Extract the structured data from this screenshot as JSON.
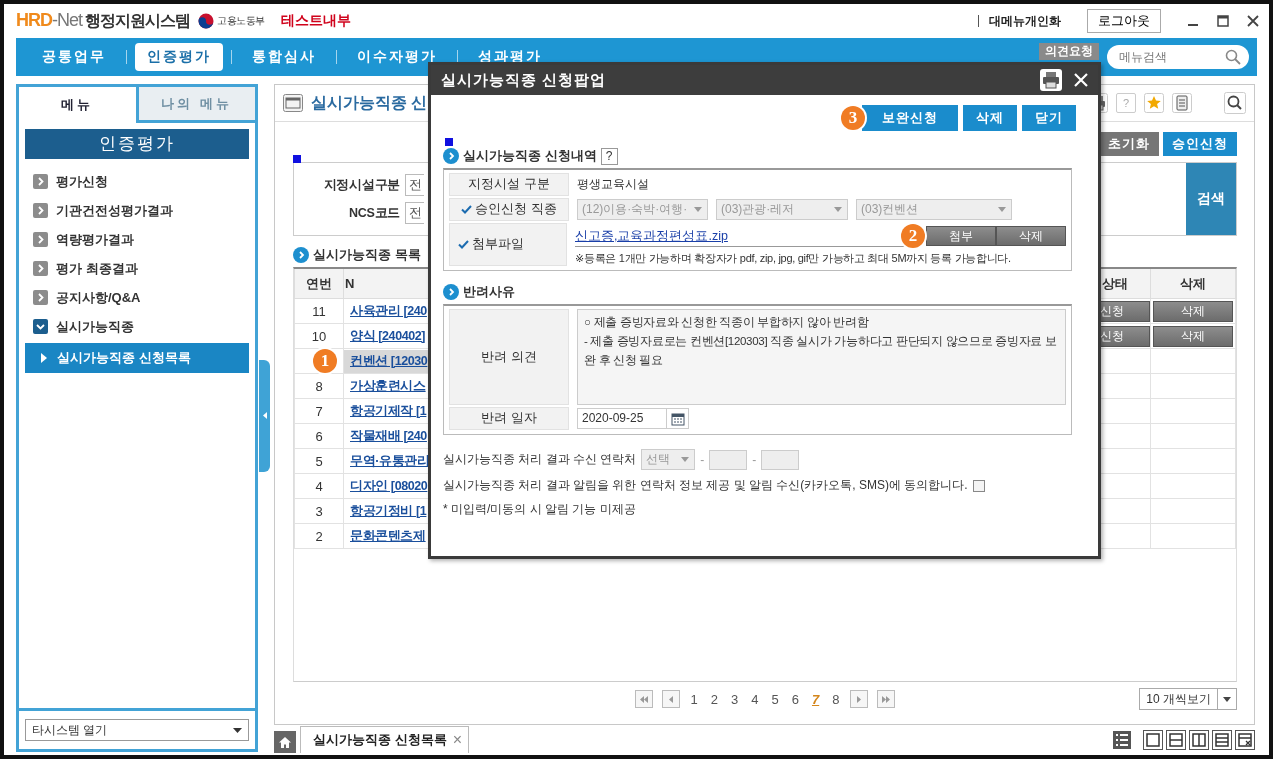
{
  "app": {
    "logo_mark": "HRD",
    "logo_net": "-Net",
    "logo_title": "행정지원시스템",
    "ministry": "고용노동부",
    "env_label": "테스트내부",
    "personalize": "대메뉴개인화",
    "logout": "로그아웃"
  },
  "nav": {
    "items": [
      {
        "label": "공통업무",
        "selected": false
      },
      {
        "label": "인증평가",
        "selected": true
      },
      {
        "label": "통합심사",
        "selected": false
      },
      {
        "label": "이수자평가",
        "selected": false
      },
      {
        "label": "성과평가",
        "selected": false
      }
    ],
    "feedback": "의견요청",
    "search_placeholder": "메뉴검색"
  },
  "sidebar": {
    "tabs": [
      {
        "label": "메뉴",
        "selected": true
      },
      {
        "label": "나의 메뉴",
        "selected": false
      }
    ],
    "title": "인증평가",
    "items": [
      {
        "label": "평가신청",
        "expanded": false
      },
      {
        "label": "기관건전성평가결과",
        "expanded": false
      },
      {
        "label": "역량평가결과",
        "expanded": false
      },
      {
        "label": "평가 최종결과",
        "expanded": false
      },
      {
        "label": "공지사항/Q&A",
        "expanded": false
      },
      {
        "label": "실시가능직종",
        "expanded": true,
        "children": [
          {
            "label": "실시가능직종 신청목록",
            "selected": true
          }
        ]
      }
    ],
    "system_select": "타시스템 열기"
  },
  "main": {
    "title": "실시가능직종 신",
    "toolbar_help": "?",
    "buttons": [
      {
        "label": "초기화",
        "kind": "secondary"
      },
      {
        "label": "승인신청",
        "kind": "primary"
      }
    ],
    "filters": [
      {
        "label": "지정시설구분",
        "value": "전"
      },
      {
        "label": "NCS코드",
        "value": "전"
      }
    ],
    "search_button": "검색",
    "list_title": "실시가능직종 목록",
    "table": {
      "columns": [
        "연번",
        "N",
        "상태",
        "삭제"
      ],
      "rows": [
        {
          "no": "11",
          "name": "사육관리 [240",
          "status": "신청",
          "delete": "삭제",
          "selected": false
        },
        {
          "no": "10",
          "name": "양식 [240402]",
          "status": "신청",
          "delete": "삭제",
          "selected": false
        },
        {
          "callout": "1",
          "name": "컨벤션 [12030",
          "selected": true
        },
        {
          "no": "8",
          "name": "가상훈련시스",
          "selected": false
        },
        {
          "no": "7",
          "name": "항공기제작 [1",
          "selected": false
        },
        {
          "no": "6",
          "name": "작물재배 [240",
          "selected": false
        },
        {
          "no": "5",
          "name": "무역·유통관리",
          "selected": false
        },
        {
          "no": "4",
          "name": "디자인 [08020",
          "selected": false
        },
        {
          "no": "3",
          "name": "항공기정비 [1",
          "selected": false
        },
        {
          "no": "2",
          "name": "문화콘텐츠제",
          "selected": false
        }
      ]
    },
    "pages": [
      {
        "label": "1",
        "selected": false
      },
      {
        "label": "2",
        "selected": false
      },
      {
        "label": "3",
        "selected": false
      },
      {
        "label": "4",
        "selected": false
      },
      {
        "label": "5",
        "selected": false
      },
      {
        "label": "6",
        "selected": false
      },
      {
        "label": "7",
        "selected": true
      },
      {
        "label": "8",
        "selected": false
      }
    ],
    "page_size": "10 개씩보기"
  },
  "bottom_tabs": [
    {
      "label": "실시가능직종 신청목록",
      "close": "×",
      "selected": true
    }
  ],
  "popup": {
    "title": "실시가능직종 신청팝업",
    "actions": [
      {
        "label": "보완신청",
        "callout": "3"
      },
      {
        "label": "삭제"
      },
      {
        "label": "닫기"
      }
    ],
    "application": {
      "title": "실시가능직종 신청내역",
      "help": "?",
      "facility_label": "지정시설 구분",
      "facility_value": "평생교육시설",
      "job_label": "승인신청 직종",
      "job_selects": [
        "(12)이용·숙박·여행·",
        "(03)관광·레저",
        "(03)컨벤션"
      ],
      "file_label": "첨부파일",
      "file_name": "신고증,교육과정편성표.zip",
      "file_callout": "2",
      "file_buttons": [
        "첨부",
        "삭제"
      ],
      "file_note": "※등록은 1개만 가능하며 확장자가 pdf, zip, jpg, gif만 가능하고 최대 5M까지 등록 가능합니다."
    },
    "rejection": {
      "title": "반려사유",
      "opinion_label": "반려 의견",
      "opinion_text": "○ 제출 증빙자료와 신청한 직종이 부합하지 않아 반려함\n - 제출 증빙자료로는 컨벤션[120303] 직종 실시가 가능하다고 판단되지 않으므로 증빙자료 보완 후 신청 필요",
      "date_label": "반려 일자",
      "date_value": "2020-09-25"
    },
    "contact": {
      "label": "실시가능직종 처리 결과 수신 연락처",
      "select": "선택",
      "separators": [
        "-",
        "-"
      ]
    },
    "consent": {
      "label": "실시가능직종 처리 결과 알림을 위한 연락처 정보 제공 및 알림 수신(카카오톡, SMS)에 동의합니다.",
      "checked": false
    },
    "note": "* 미입력/미동의 시 알림 기능 미제공"
  }
}
